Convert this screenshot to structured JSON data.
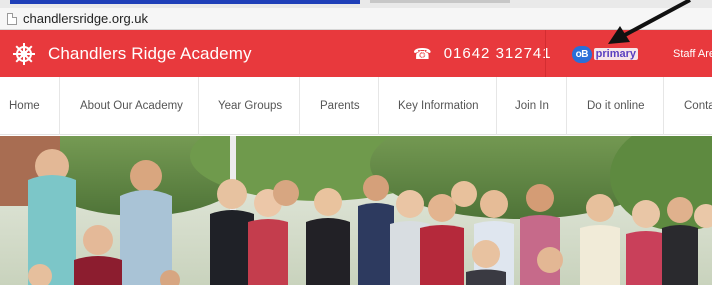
{
  "browser": {
    "url": "chandlersridge.org.uk",
    "page_icon": "page-icon"
  },
  "header": {
    "school_name": "Chandlers Ridge Academy",
    "logo_icon": "ships-wheel-icon",
    "phone_icon": "telephone-icon",
    "phone": "01642 312741",
    "partner_logo_mark": "oB",
    "partner_logo_word": "primary",
    "staff_link": "Staff Are",
    "brand_color": "#e8393d"
  },
  "nav": {
    "items": [
      "Home",
      "About Our Academy",
      "Year Groups",
      "Parents",
      "Key Information",
      "Join In",
      "Do it online",
      "Conta"
    ]
  },
  "hero": {
    "description_icon": "staff-group-photo"
  }
}
